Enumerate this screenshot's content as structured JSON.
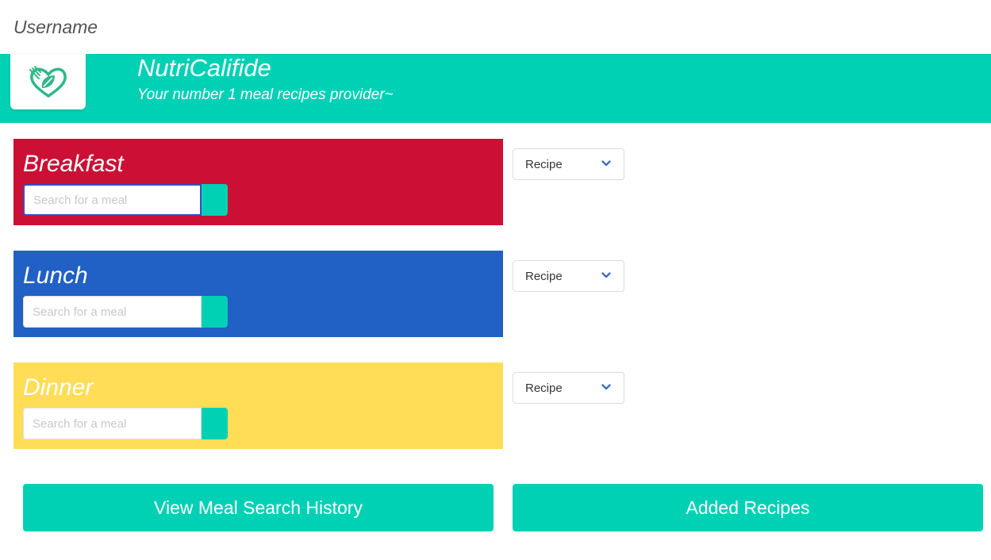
{
  "user": {
    "username": "Username"
  },
  "header": {
    "brand_name": "NutriCalifide",
    "tagline": "Your number 1 meal recipes provider~",
    "logo_icon": "heart-leaf-fork-logo",
    "background_color": "#00d1b5"
  },
  "meals": [
    {
      "title": "Breakfast",
      "search_placeholder": "Search for a meal",
      "search_value": "",
      "select_value": "Recipe",
      "color": "#cc0f35"
    },
    {
      "title": "Lunch",
      "search_placeholder": "Search for a meal",
      "search_value": "",
      "select_value": "Recipe",
      "color": "#2160c4"
    },
    {
      "title": "Dinner",
      "search_placeholder": "Search for a meal",
      "search_value": "",
      "select_value": "Recipe",
      "color": "#ffdd57"
    }
  ],
  "actions": {
    "history_label": "View Meal Search History",
    "added_label": "Added Recipes"
  },
  "colors": {
    "accent": "#00d1b5",
    "select_chevron": "#3e6fce"
  }
}
